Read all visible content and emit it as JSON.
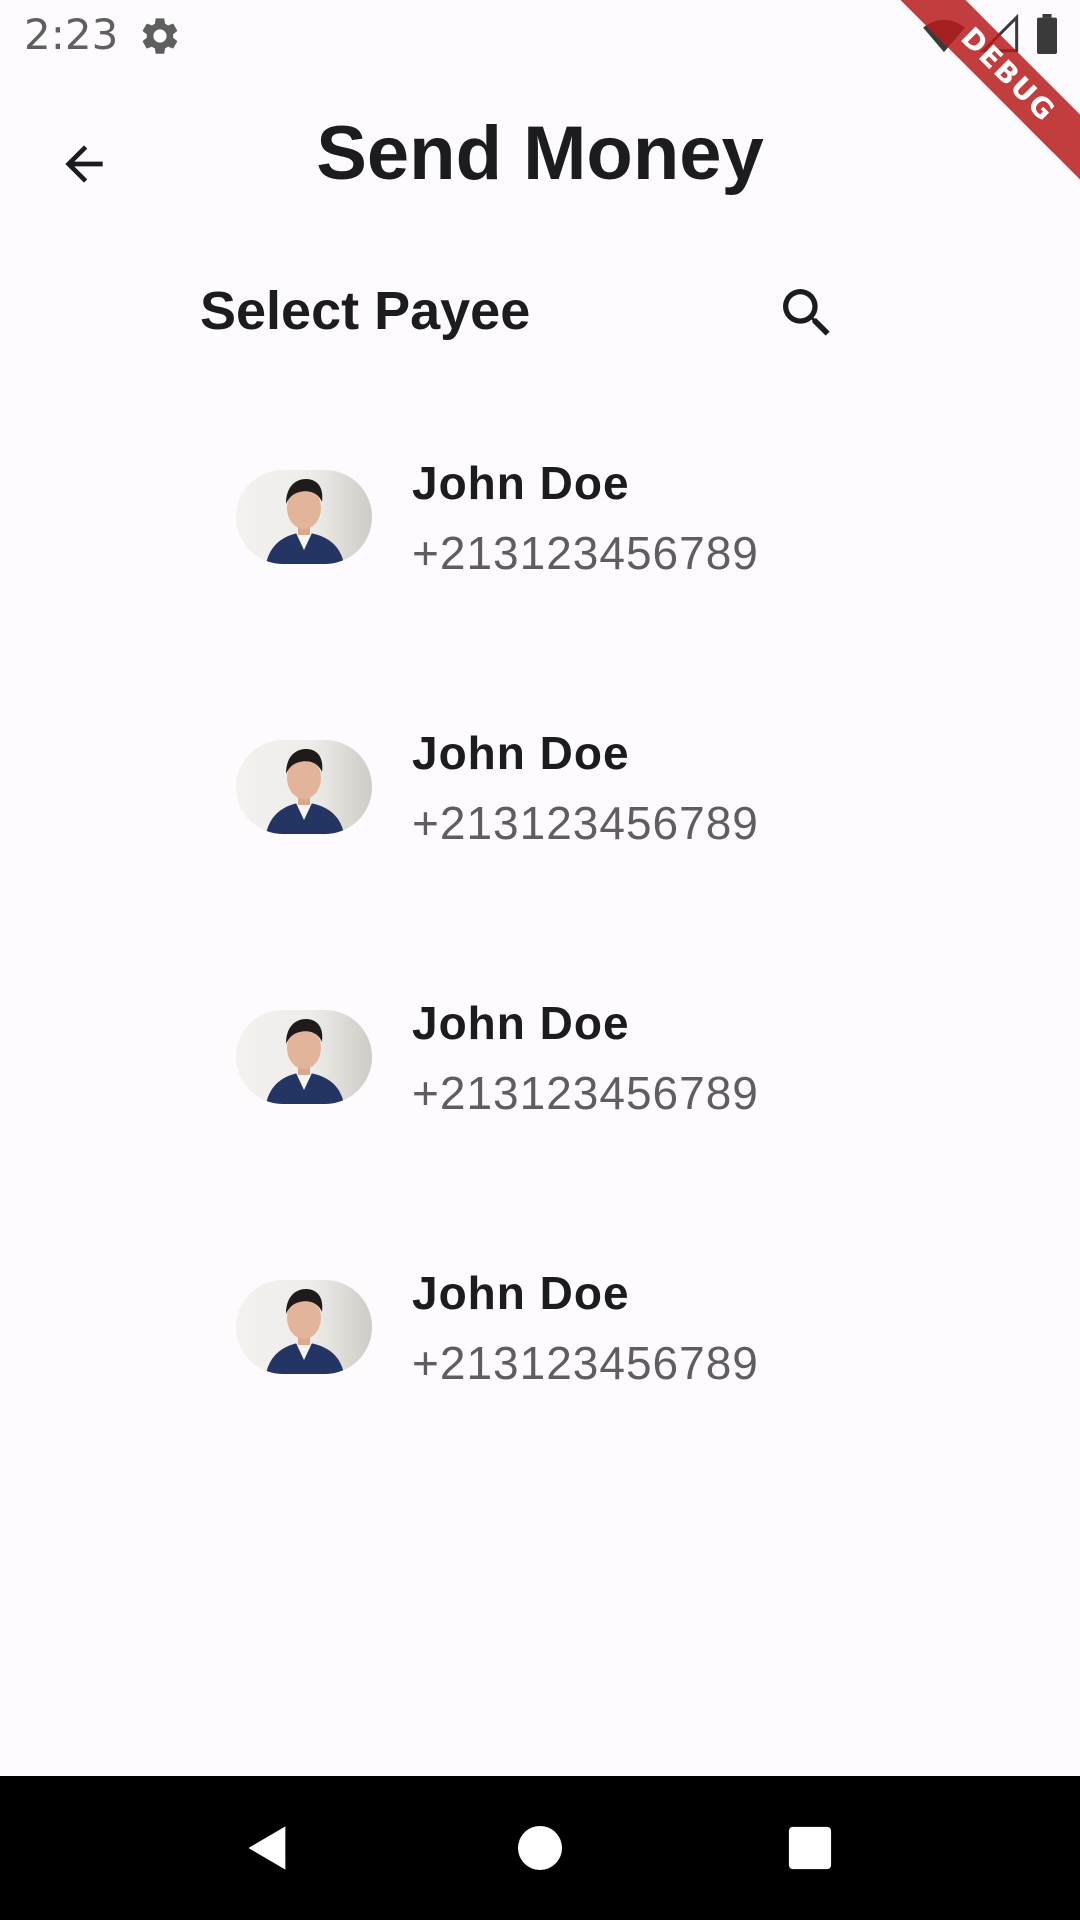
{
  "status_bar": {
    "time": "2:23",
    "icons": [
      "gear-icon",
      "wifi-icon",
      "signal-icon",
      "battery-icon"
    ]
  },
  "debug_banner": {
    "label": "DEBUG",
    "color": "#b71c1c"
  },
  "app_bar": {
    "title": "Send Money",
    "back_icon": "arrow-left-icon"
  },
  "section": {
    "title": "Select Payee",
    "search_icon": "search-icon"
  },
  "payees": [
    {
      "name": "John Doe",
      "phone": "+213123456789"
    },
    {
      "name": "John Doe",
      "phone": "+213123456789"
    },
    {
      "name": "John Doe",
      "phone": "+213123456789"
    },
    {
      "name": "John Doe",
      "phone": "+213123456789"
    }
  ],
  "nav_bar": {
    "icons": [
      "back-triangle-icon",
      "home-circle-icon",
      "recents-square-icon"
    ]
  },
  "colors": {
    "background": "#fefbfe",
    "text_primary": "#1c1b1f",
    "text_secondary": "#5f5d62",
    "nav_bar": "#000000"
  }
}
